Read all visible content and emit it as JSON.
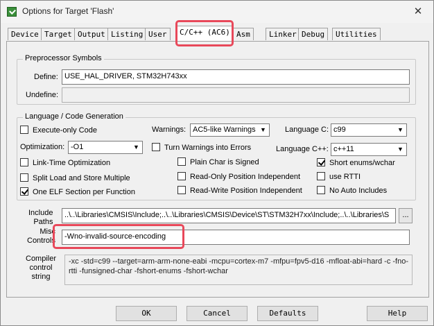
{
  "window": {
    "title": "Options for Target 'Flash'",
    "close_glyph": "✕"
  },
  "tabs": [
    {
      "label": "Device"
    },
    {
      "label": "Target"
    },
    {
      "label": "Output"
    },
    {
      "label": "Listing"
    },
    {
      "label": "User"
    },
    {
      "label": "C/C++ (AC6)"
    },
    {
      "label": "Asm"
    },
    {
      "label": "Linker"
    },
    {
      "label": "Debug"
    },
    {
      "label": "Utilities"
    }
  ],
  "active_tab": "C/C++ (AC6)",
  "preprocessor": {
    "title": "Preprocessor Symbols",
    "define_label": "Define:",
    "define_value": "USE_HAL_DRIVER, STM32H743xx",
    "undefine_label": "Undefine:",
    "undefine_value": ""
  },
  "language": {
    "title": "Language / Code Generation",
    "execute_only": {
      "label": "Execute-only Code",
      "checked": false
    },
    "warnings_label": "Warnings:",
    "warnings_value": "AC5-like Warnings",
    "language_c_label": "Language C:",
    "language_c_value": "c99",
    "optimization_label": "Optimization:",
    "optimization_value": "-O1",
    "turn_warnings": {
      "label": "Turn Warnings into Errors",
      "checked": false
    },
    "language_cpp_label": "Language C++:",
    "language_cpp_value": "c++11",
    "link_time": {
      "label": "Link-Time Optimization",
      "checked": false
    },
    "plain_char": {
      "label": "Plain Char is Signed",
      "checked": false
    },
    "short_enums": {
      "label": "Short enums/wchar",
      "checked": true
    },
    "split_load": {
      "label": "Split Load and Store Multiple",
      "checked": false
    },
    "ro_pi": {
      "label": "Read-Only Position Independent",
      "checked": false
    },
    "use_rtti": {
      "label": "use RTTI",
      "checked": false
    },
    "one_elf": {
      "label": "One ELF Section per Function",
      "checked": true
    },
    "rw_pi": {
      "label": "Read-Write Position Independent",
      "checked": false
    },
    "no_auto_includes": {
      "label": "No Auto Includes",
      "checked": false
    }
  },
  "include_paths": {
    "label_line1": "Include",
    "label_line2": "Paths",
    "value": "..\\..\\Libraries\\CMSIS\\Include;..\\..\\Libraries\\CMSIS\\Device\\ST\\STM32H7xx\\Include;..\\..\\Libraries\\S",
    "browse_label": "..."
  },
  "misc_controls": {
    "label_line1": "Misc",
    "label_line2": "Controls",
    "value": "-Wno-invalid-source-encoding"
  },
  "compiler_string": {
    "label_line1": "Compiler",
    "label_line2": "control",
    "label_line3": "string",
    "value": "-xc -std=c99 --target=arm-arm-none-eabi -mcpu=cortex-m7 -mfpu=fpv5-d16 -mfloat-abi=hard -c -fno-rtti -funsigned-char -fshort-enums -fshort-wchar"
  },
  "buttons": {
    "ok": "OK",
    "cancel": "Cancel",
    "defaults": "Defaults",
    "help": "Help"
  },
  "highlight_color": "#e8485a"
}
